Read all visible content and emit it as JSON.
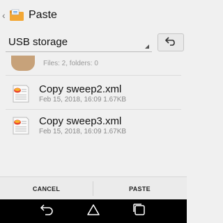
{
  "header": {
    "title": "Paste"
  },
  "path": {
    "storage_label": "USB storage"
  },
  "files": {
    "folder_meta": "Files: 2, folders: 0",
    "items": [
      {
        "name": "Copy sweep2.xml",
        "meta": "Feb 15, 2018, 16:09 1.67KB"
      },
      {
        "name": "Copy sweep3.xml",
        "meta": "Feb 15, 2018, 16:09 1.67KB"
      }
    ]
  },
  "actions": {
    "cancel_label": "CANCEL",
    "paste_label": "PASTE"
  },
  "icons": {
    "back": "back-chevron-icon",
    "app": "paste-folder-icon",
    "up": "up-folder-icon",
    "file": "xml-file-icon",
    "nav_back": "nav-back-icon",
    "nav_home": "nav-home-icon",
    "nav_recent": "nav-recent-icon"
  }
}
